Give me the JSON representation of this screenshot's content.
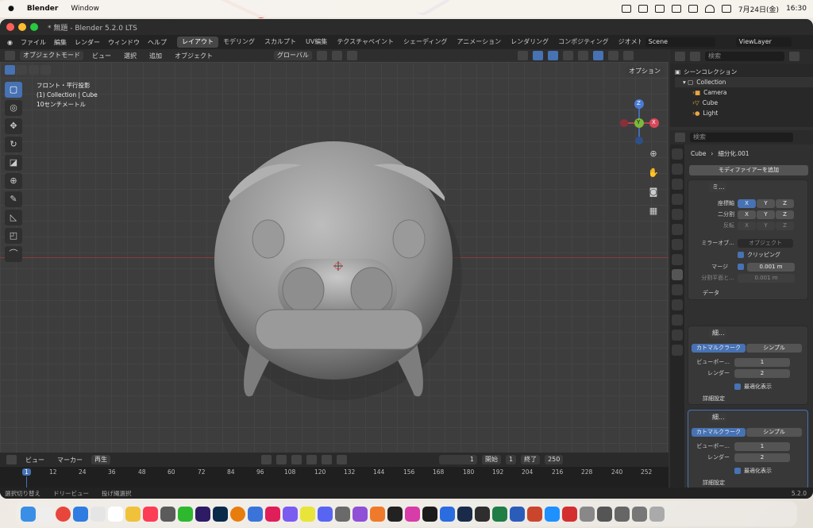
{
  "menubar": {
    "app": "Blender",
    "items": [
      "Window"
    ],
    "status_date": "7月24日(金)",
    "time": "16:30"
  },
  "window": {
    "title": "* 無題 - Blender 5.2.0 LTS"
  },
  "topbar": {
    "menus": [
      "ファイル",
      "編集",
      "レンダー",
      "ウィンドウ",
      "ヘルプ"
    ],
    "workspaces": [
      "レイアウト",
      "モデリング",
      "スカルプト",
      "UV編集",
      "テクスチャペイント",
      "シェーディング",
      "アニメーション",
      "レンダリング",
      "コンポジティング",
      "ジオメトリ"
    ],
    "scene": "Scene",
    "viewlayer": "ViewLayer"
  },
  "viewport": {
    "mode": "オブジェクトモード",
    "menus": [
      "ビュー",
      "選択",
      "追加",
      "オブジェクト"
    ],
    "orientation": "グローバル",
    "options": "オプション",
    "info": [
      "フロント・平行投影",
      "(1) Collection | Cube",
      "10センチメートル"
    ],
    "gizmo": {
      "z": "Z",
      "y": "Y",
      "x": "X"
    }
  },
  "timeline": {
    "menus": [
      "ビュー",
      "マーカー",
      "再生"
    ],
    "current": "1",
    "start_label": "開始",
    "start": "1",
    "end_label": "終了",
    "end": "250",
    "ticks": [
      "1",
      "12",
      "24",
      "36",
      "48",
      "60",
      "72",
      "84",
      "96",
      "108",
      "120",
      "132",
      "144",
      "156",
      "168",
      "180",
      "192",
      "204",
      "216",
      "228",
      "240",
      "252"
    ]
  },
  "status": {
    "items": [
      "選択切り替え",
      "ドリービュー",
      "投げ縄選択"
    ],
    "version": "5.2.0"
  },
  "outliner": {
    "search_placeholder": "検索",
    "root": "シーンコレクション",
    "collection": "Collection",
    "items": [
      "Camera",
      "Cube",
      "Light"
    ]
  },
  "properties": {
    "search_placeholder": "検索",
    "breadcrumb_obj": "Cube",
    "breadcrumb_mod": "細分化.001",
    "add_modifier": "モディファイアーを追加",
    "mirror": {
      "name": "ミ...",
      "axis_label": "座標軸",
      "bisect_label": "二分割",
      "flip_label": "反転",
      "axes": [
        "X",
        "Y",
        "Z"
      ],
      "mirror_obj_label": "ミラーオブ...",
      "mirror_obj_placeholder": "オブジェクト",
      "clipping": "クリッピング",
      "merge_label": "マージ",
      "merge_value": "0.001 m",
      "bisect_dist_label": "分割平面と...",
      "bisect_dist_value": "0.001 m",
      "data": "データ"
    },
    "subsurf1": {
      "name": "細...",
      "type_a": "カトマルクラーク",
      "type_b": "シンプル",
      "viewport_label": "ビューポー...",
      "viewport": "1",
      "render_label": "レンダー",
      "render": "2",
      "optimal": "最適化表示",
      "advanced": "詳細設定"
    },
    "subsurf2": {
      "name": "細...",
      "type_a": "カトマルクラーク",
      "type_b": "シンプル",
      "viewport_label": "ビューポー...",
      "viewport": "1",
      "render_label": "レンダー",
      "render": "2",
      "optimal": "最適化表示",
      "advanced": "詳細設定"
    }
  }
}
